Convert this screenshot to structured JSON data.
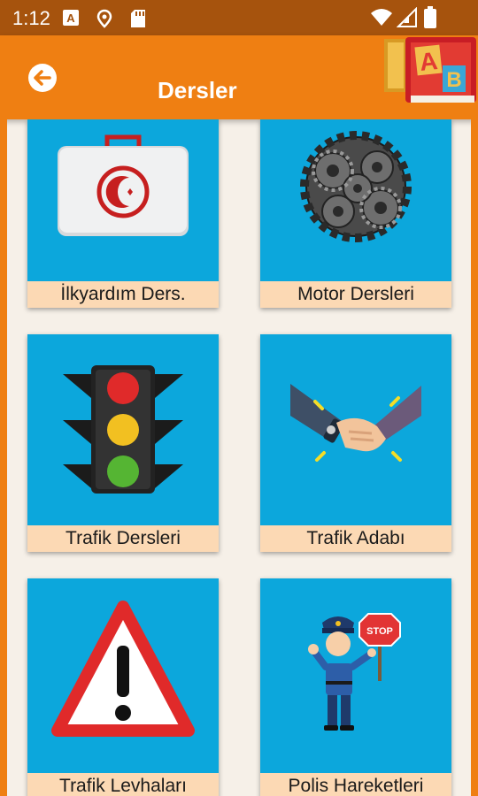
{
  "status_bar": {
    "time": "1:12",
    "icons": [
      "a-notification-icon",
      "location-icon",
      "sd-card-icon",
      "wifi-icon",
      "signal-icon",
      "battery-icon"
    ]
  },
  "app_bar": {
    "title": "Dersler",
    "back_icon": "arrow-left-icon",
    "logo_letters": [
      "A",
      "B"
    ],
    "color": "#ef7f12"
  },
  "cards": [
    {
      "label": "İlkyardım Ders.",
      "icon": "first-aid-kit-icon"
    },
    {
      "label": "Motor Dersleri",
      "icon": "gears-icon"
    },
    {
      "label": "Trafik Dersleri",
      "icon": "traffic-light-icon"
    },
    {
      "label": "Trafik Adabı",
      "icon": "handshake-icon"
    },
    {
      "label": "Trafik Levhaları",
      "icon": "warning-sign-icon"
    },
    {
      "label": "Polis Hareketleri",
      "icon": "police-officer-icon"
    }
  ],
  "colors": {
    "card_bg": "#0ca7dc",
    "label_bg": "#fcd9b4",
    "status_bar": "#a6530d",
    "page_bg": "#f6f0e8"
  },
  "stop_sign_text": "STOP"
}
